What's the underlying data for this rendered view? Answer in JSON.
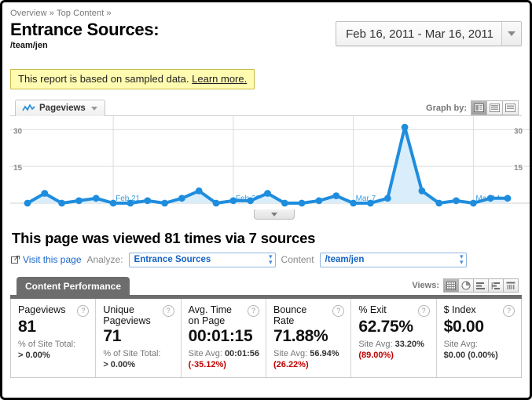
{
  "breadcrumb": "Overview » Top Content »",
  "page_title": "Entrance Sources:",
  "page_subtitle": "/team/jen",
  "date_picker": {
    "range": "Feb 16, 2011 - Mar 16, 2011",
    "icon": "chevron-down-icon"
  },
  "notice": {
    "text": "This report is based on sampled data.",
    "link": "Learn more."
  },
  "graph": {
    "legend_label": "Pageviews",
    "legend_icon": "sparkline-icon",
    "graph_by_label": "Graph by:",
    "graph_by_options": [
      "day",
      "week",
      "month"
    ],
    "graph_by_selected": "day"
  },
  "summary": "This page was viewed 81 times via 7 sources",
  "controls": {
    "visit_link": "Visit this page",
    "visit_icon": "external-link-icon",
    "analyze_label": "Analyze:",
    "analyze_value": "Entrance Sources",
    "content_label": "Content",
    "content_value": "/team/jen"
  },
  "content_performance": {
    "tab_label": "Content Performance",
    "views_label": "Views:",
    "view_icons": [
      "table-view-icon",
      "pie-view-icon",
      "bar-view-icon",
      "comparison-view-icon",
      "pivot-view-icon"
    ],
    "view_selected": "table-view-icon",
    "metrics": [
      {
        "name": "Pageviews",
        "value": "81",
        "sub_label": "% of Site Total:",
        "sub_value": "> 0.00%",
        "delta": ""
      },
      {
        "name": "Unique Pageviews",
        "value": "71",
        "sub_label": "% of Site Total:",
        "sub_value": "> 0.00%",
        "delta": ""
      },
      {
        "name": "Avg. Time on Page",
        "value": "00:01:15",
        "sub_label": "Site Avg:",
        "sub_value": "00:01:56",
        "delta": "(-35.12%)"
      },
      {
        "name": "Bounce Rate",
        "value": "71.88%",
        "sub_label": "Site Avg:",
        "sub_value": "56.94%",
        "delta": "(26.22%)"
      },
      {
        "name": "% Exit",
        "value": "62.75%",
        "sub_label": "Site Avg:",
        "sub_value": "33.20%",
        "delta": "(89.00%)"
      },
      {
        "name": "$ Index",
        "value": "$0.00",
        "sub_label": "Site Avg:",
        "sub_value": "$0.00 (0.00%)",
        "delta": ""
      }
    ],
    "help_icon": "question-mark-icon"
  },
  "colors": {
    "accent": "#1f8ddd",
    "fill": "#d9edfb",
    "negative": "#c00000",
    "tab_bg": "#6d6d6d",
    "notice_bg": "#fffbb0",
    "link": "#1a66cc"
  },
  "chart_data": {
    "type": "line",
    "title": "Pageviews",
    "xlabel": "",
    "ylabel": "Pageviews",
    "ylim": [
      0,
      33
    ],
    "yticks": [
      15,
      30
    ],
    "grid": true,
    "legend": [
      "Pageviews"
    ],
    "x": [
      "Feb 16",
      "Feb 17",
      "Feb 18",
      "Feb 19",
      "Feb 20",
      "Feb 21",
      "Feb 22",
      "Feb 23",
      "Feb 24",
      "Feb 25",
      "Feb 26",
      "Feb 27",
      "Feb 28",
      "Mar 1",
      "Mar 2",
      "Mar 3",
      "Mar 4",
      "Mar 5",
      "Mar 6",
      "Mar 7",
      "Mar 8",
      "Mar 9",
      "Mar 10",
      "Mar 11",
      "Mar 12",
      "Mar 13",
      "Mar 14",
      "Mar 15",
      "Mar 16"
    ],
    "tick_labels": [
      "Feb 21",
      "Feb 28",
      "Mar 7",
      "Mar 14"
    ],
    "tick_indices": [
      5,
      12,
      19,
      26
    ],
    "values": [
      0,
      4,
      0,
      1,
      2,
      0,
      0,
      1,
      0,
      2,
      5,
      0,
      1,
      1,
      4,
      0,
      0,
      1,
      3,
      0,
      0,
      2,
      31,
      5,
      0,
      1,
      0,
      2,
      2
    ],
    "series": [
      {
        "name": "Pageviews",
        "values": [
          0,
          4,
          0,
          1,
          2,
          0,
          0,
          1,
          0,
          2,
          5,
          0,
          1,
          1,
          4,
          0,
          0,
          1,
          3,
          0,
          0,
          2,
          31,
          5,
          0,
          1,
          0,
          2,
          2
        ]
      }
    ]
  }
}
